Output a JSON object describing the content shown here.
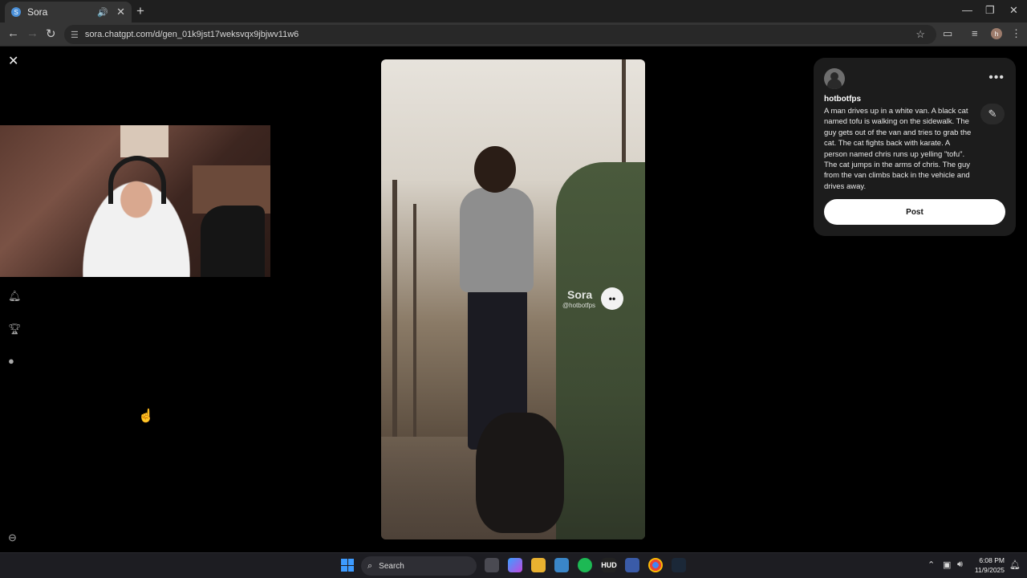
{
  "browser": {
    "tab_title": "Sora",
    "tab_favicon": "S",
    "url": "sora.chatgpt.com/d/gen_01k9jst17weksvqx9jbjwv11w6",
    "profile_initial": "h"
  },
  "icons": {
    "close": "✕",
    "notification": "bell-icon",
    "trophy": "trophy-icon",
    "profile": "avatar-icon",
    "settings": "circle-minus-icon"
  },
  "video": {
    "watermark": "Sora",
    "watermark_handle": "@hotbotfps"
  },
  "panel": {
    "username": "hotbotfps",
    "prompt": "A man drives up in a white van. A black cat named tofu is walking on the sidewalk. The guy gets out of the van and tries to grab the cat. The cat fights back with karate. A person named chris runs up yelling \"tofu\". The cat jumps in the arms of chris. The guy from the van climbs back in the vehicle and drives away.",
    "post_label": "Post"
  },
  "taskbar": {
    "search_label": "Search",
    "time": "6:08 PM",
    "date": "11/9/2025",
    "apps": [
      "file-explorer-icon",
      "copilot-icon",
      "folder-icon",
      "notepad-icon",
      "spotify-icon",
      "hud-fx-icon",
      "app-icon",
      "chrome-icon",
      "steam-icon"
    ]
  },
  "colors": {
    "background": "#000000",
    "panel": "#1c1c1c",
    "post_button": "#ffffff",
    "chrome_toolbar": "#353535",
    "taskbar": "#1d1d22"
  }
}
